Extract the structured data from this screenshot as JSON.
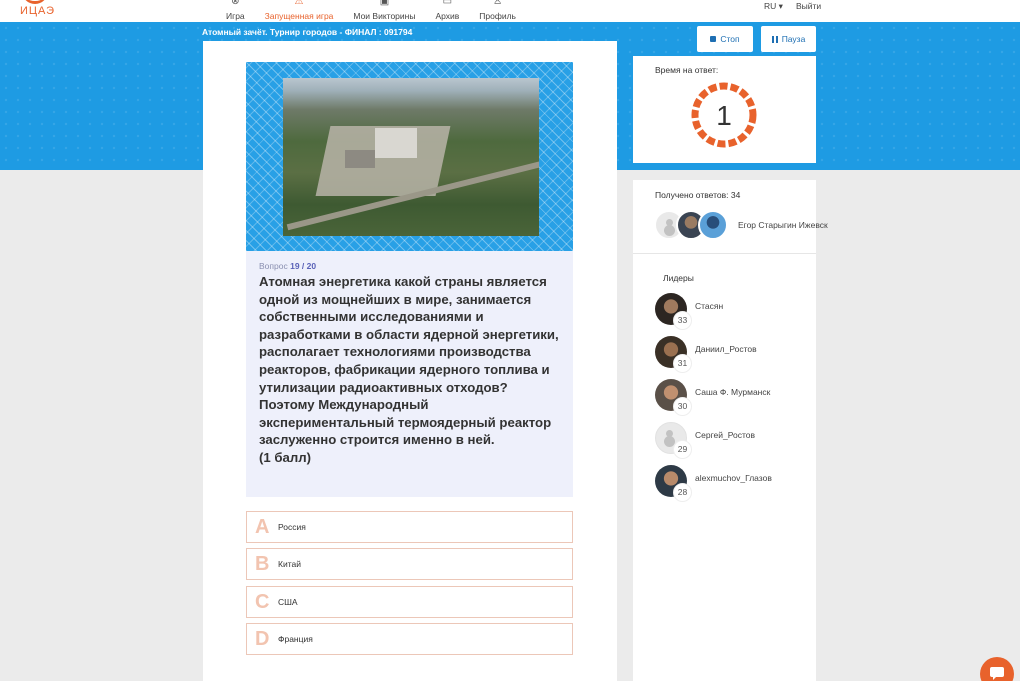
{
  "nav": {
    "logo_text": "ИЦАЭ",
    "items": [
      {
        "label": "Игра",
        "icon": "gamepad-icon",
        "active": false
      },
      {
        "label": "Запущенная игра",
        "icon": "running-game-icon",
        "active": true
      },
      {
        "label": "Мои Викторины",
        "icon": "quizzes-icon",
        "active": false
      },
      {
        "label": "Архив",
        "icon": "archive-icon",
        "active": false
      },
      {
        "label": "Профиль",
        "icon": "profile-icon",
        "active": false
      }
    ],
    "lang": "RU ▾",
    "logout": "Выйти"
  },
  "game": {
    "title": "Атомный зачёт. Турнир городов - ФИНАЛ : 091794",
    "stop_label": "Стоп",
    "pause_label": "Пауза"
  },
  "question": {
    "number_prefix": "Вопрос",
    "number": "19 / 20",
    "text": "Атомная энергетика какой страны является одной из мощнейших в мире, занимается собственными исследованиями и разработками в области ядерной энергетики, располагает технологиями производства реакторов, фабрикации ядерного топлива и утилизации радиоактивных отходов? Поэтому Международный экспериментальный термоядерный реактор заслуженно строится именно в ней.",
    "points": "(1 балл)"
  },
  "answers": [
    {
      "letter": "A",
      "text": "Россия"
    },
    {
      "letter": "B",
      "text": "Китай"
    },
    {
      "letter": "C",
      "text": "США"
    },
    {
      "letter": "D",
      "text": "Франция"
    }
  ],
  "timer": {
    "label": "Время на ответ:",
    "value": "1",
    "remaining_fraction": 1.0,
    "color": "#e8622c"
  },
  "responses": {
    "label": "Получено ответов: 34",
    "recent_name": "Егор Старыгин Ижевск"
  },
  "leaders": {
    "label": "Лидеры",
    "items": [
      {
        "name": "Стасян",
        "score": "33"
      },
      {
        "name": "Даниил_Ростов",
        "score": "31"
      },
      {
        "name": "Саша Ф. Мурманск",
        "score": "30"
      },
      {
        "name": "Сергей_Ростов",
        "score": "29"
      },
      {
        "name": "alexmuchov_Глазов",
        "score": "28"
      }
    ]
  },
  "colors": {
    "brand": "#e8622c",
    "band": "#1e9be3",
    "question_bg": "#eef0fb"
  }
}
